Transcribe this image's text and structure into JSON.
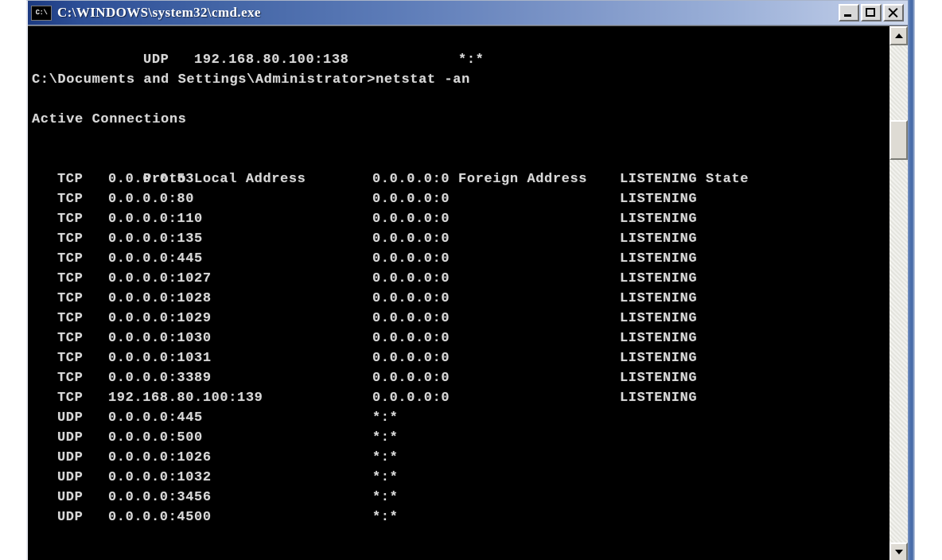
{
  "window": {
    "title": "C:\\WINDOWS\\system32\\cmd.exe",
    "icon_label": "C:\\",
    "icon_name": "cmd-console-icon",
    "buttons": {
      "minimize": "Minimize",
      "maximize": "Maximize",
      "close": "Close"
    },
    "colors": {
      "title_gradient_start": "#1c3a80",
      "title_gradient_end": "#cfd9ec",
      "console_background": "#000000",
      "console_foreground": "#d8d8d8",
      "chrome_face": "#d4d0c8"
    }
  },
  "scrollbar": {
    "up_arrow": "▲",
    "down_arrow": "▼",
    "thumb_label": "vertical-scroll-thumb"
  },
  "console": {
    "prompt_line": "C:\\Documents and Settings\\Administrator>netstat -an",
    "section_title": "Active Connections",
    "headers": {
      "proto": "Proto",
      "local": "Local Address",
      "foreign": "Foreign Address",
      "state": "State"
    },
    "previous_output": {
      "proto": "UDP",
      "local": "192.168.80.100:138",
      "foreign": "*:*",
      "state": ""
    },
    "rows": [
      {
        "proto": "TCP",
        "local": "0.0.0.0:53",
        "foreign": "0.0.0.0:0",
        "state": "LISTENING"
      },
      {
        "proto": "TCP",
        "local": "0.0.0.0:80",
        "foreign": "0.0.0.0:0",
        "state": "LISTENING"
      },
      {
        "proto": "TCP",
        "local": "0.0.0.0:110",
        "foreign": "0.0.0.0:0",
        "state": "LISTENING"
      },
      {
        "proto": "TCP",
        "local": "0.0.0.0:135",
        "foreign": "0.0.0.0:0",
        "state": "LISTENING"
      },
      {
        "proto": "TCP",
        "local": "0.0.0.0:445",
        "foreign": "0.0.0.0:0",
        "state": "LISTENING"
      },
      {
        "proto": "TCP",
        "local": "0.0.0.0:1027",
        "foreign": "0.0.0.0:0",
        "state": "LISTENING"
      },
      {
        "proto": "TCP",
        "local": "0.0.0.0:1028",
        "foreign": "0.0.0.0:0",
        "state": "LISTENING"
      },
      {
        "proto": "TCP",
        "local": "0.0.0.0:1029",
        "foreign": "0.0.0.0:0",
        "state": "LISTENING"
      },
      {
        "proto": "TCP",
        "local": "0.0.0.0:1030",
        "foreign": "0.0.0.0:0",
        "state": "LISTENING"
      },
      {
        "proto": "TCP",
        "local": "0.0.0.0:1031",
        "foreign": "0.0.0.0:0",
        "state": "LISTENING"
      },
      {
        "proto": "TCP",
        "local": "0.0.0.0:3389",
        "foreign": "0.0.0.0:0",
        "state": "LISTENING"
      },
      {
        "proto": "TCP",
        "local": "192.168.80.100:139",
        "foreign": "0.0.0.0:0",
        "state": "LISTENING"
      },
      {
        "proto": "UDP",
        "local": "0.0.0.0:445",
        "foreign": "*:*",
        "state": ""
      },
      {
        "proto": "UDP",
        "local": "0.0.0.0:500",
        "foreign": "*:*",
        "state": ""
      },
      {
        "proto": "UDP",
        "local": "0.0.0.0:1026",
        "foreign": "*:*",
        "state": ""
      },
      {
        "proto": "UDP",
        "local": "0.0.0.0:1032",
        "foreign": "*:*",
        "state": ""
      },
      {
        "proto": "UDP",
        "local": "0.0.0.0:3456",
        "foreign": "*:*",
        "state": ""
      },
      {
        "proto": "UDP",
        "local": "0.0.0.0:4500",
        "foreign": "*:*",
        "state": ""
      }
    ]
  }
}
